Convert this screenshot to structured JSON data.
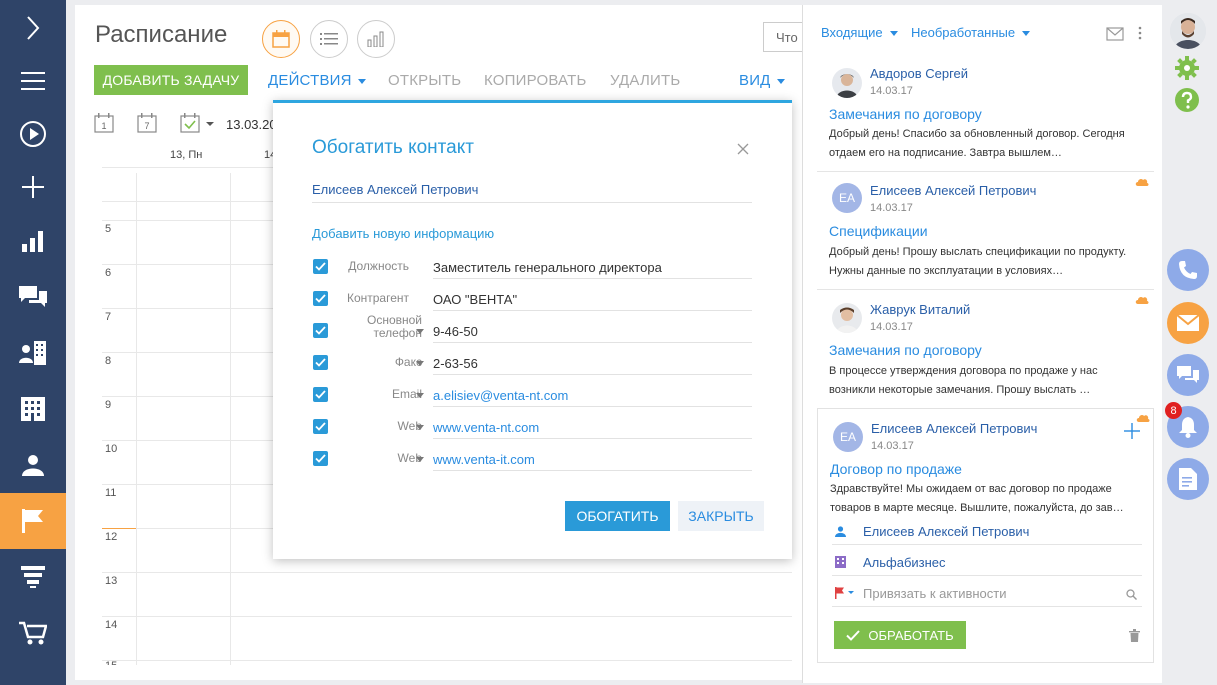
{
  "nav": {
    "items": [
      "expand",
      "menu",
      "start",
      "create",
      "dashboards",
      "feed",
      "contacts-accounts",
      "accounts",
      "contacts",
      "activities",
      "leads",
      "orders"
    ]
  },
  "main": {
    "title": "Расписание",
    "search_placeholder": "Что ",
    "add_task": "ДОБАВИТЬ ЗАДАЧУ",
    "actions": "ДЕЙСТВИЯ",
    "open": "ОТКРЫТЬ",
    "copy": "КОПИРОВАТЬ",
    "delete": "УДАЛИТЬ",
    "view": "ВИД",
    "date": "13.03.20",
    "cal_icons": [
      "1",
      "7"
    ],
    "days": [
      "13, Пн",
      "14"
    ],
    "hours": [
      "5",
      "6",
      "7",
      "8",
      "9",
      "10",
      "11",
      "12",
      "13",
      "14",
      "15"
    ]
  },
  "modal": {
    "title": "Обогатить контакт",
    "contact": "Елисеев Алексей Петрович",
    "add_info": "Добавить новую информацию",
    "fields": [
      {
        "label": "Должность",
        "value": "Заместитель генерального директора",
        "link": false,
        "dropdown": false,
        "checked": true
      },
      {
        "label": "Контрагент",
        "value": "ОАО \"ВЕНТА\"",
        "link": false,
        "dropdown": false,
        "checked": true
      },
      {
        "label": "Основной телефон",
        "value": "9-46-50",
        "link": false,
        "dropdown": true,
        "checked": true
      },
      {
        "label": "Факс",
        "value": "2-63-56",
        "link": false,
        "dropdown": true,
        "checked": true
      },
      {
        "label": "Email",
        "value": "a.elisiev@venta-nt.com",
        "link": true,
        "dropdown": true,
        "checked": true
      },
      {
        "label": "Web",
        "value": "www.venta-nt.com",
        "link": true,
        "dropdown": true,
        "checked": true
      },
      {
        "label": "Web",
        "value": "www.venta-it.com",
        "link": true,
        "dropdown": true,
        "checked": true
      }
    ],
    "enrich": "ОБОГАТИТЬ",
    "close": "ЗАКРЫТЬ"
  },
  "panel": {
    "filter_1": "Входящие",
    "filter_2": "Необработанные",
    "cards": [
      {
        "sender": "Авдоров Сергей",
        "date": "14.03.17",
        "subject": "Замечания по договору",
        "body": "Добрый день! Спасибо за обновленный договор. Сегодня отдаем его на подписание. Завтра вышлем…",
        "initials": ""
      },
      {
        "sender": "Елисеев Алексей Петрович",
        "date": "14.03.17",
        "subject": "Спецификации",
        "body": "Добрый день! Прошу выслать спецификации по продукту. Нужны данные по эксплуатации в условиях…",
        "initials": "ЕА"
      },
      {
        "sender": "Жаврук Виталий",
        "date": "14.03.17",
        "subject": "Замечания по договору",
        "body": "В процессе утверждения договора по продаже у нас возникли некоторые замечания. Прошу выслать …",
        "initials": ""
      },
      {
        "sender": "Елисеев Алексей Петрович",
        "date": "14.03.17",
        "subject": "Договор по продаже",
        "body": "Здравствуйте! Мы ожидаем от вас договор по продаже товаров в марте месяце. Вышлите, пожалуйста, до зав…",
        "initials": "ЕА"
      }
    ],
    "link_contact": "Елисеев Алексей Петрович",
    "link_account": "Альфабизнес",
    "link_activity_placeholder": "Привязать к активности",
    "process": "ОБРАБОТАТЬ"
  },
  "right_bar": {
    "notification_count": "8"
  },
  "colors": {
    "nav_bg": "#2f4468",
    "accent_orange": "#f7a243",
    "primary_blue": "#2a9ad8",
    "green": "#7fbf4d"
  }
}
